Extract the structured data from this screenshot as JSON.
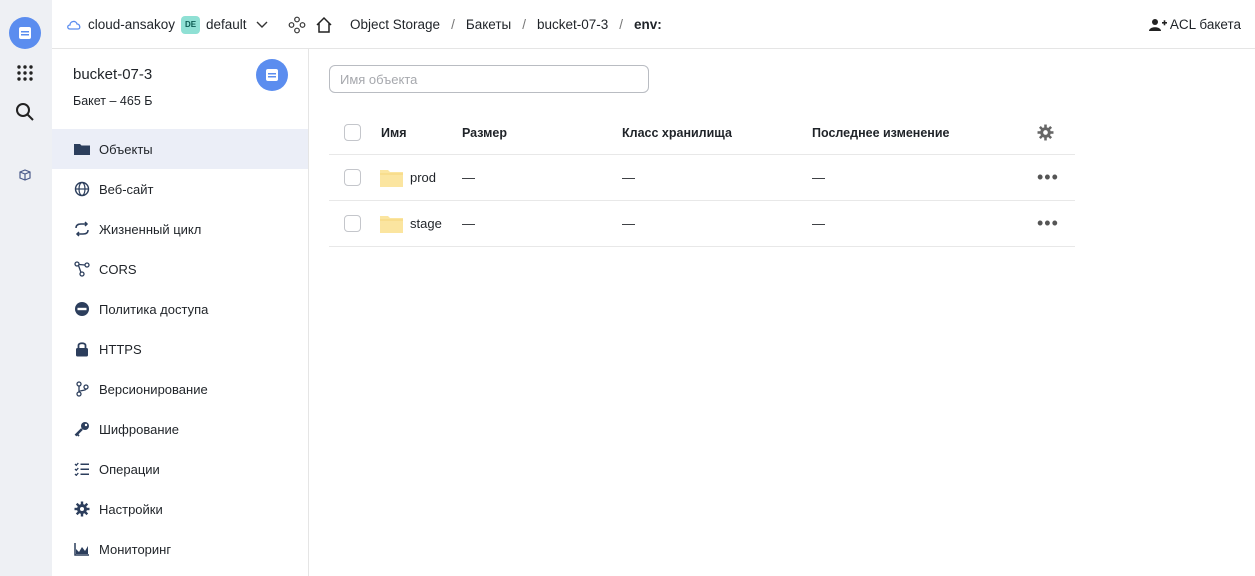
{
  "header": {
    "cloud_name": "cloud-ansakoy",
    "folder_badge": "DE",
    "folder_name": "default",
    "breadcrumbs": [
      "Object Storage",
      "Бакеты",
      "bucket-07-3",
      "env:"
    ],
    "separator": "/",
    "acl_label": "ACL бакета"
  },
  "sidebar": {
    "bucket_name": "bucket-07-3",
    "bucket_info": "Бакет – 465 Б",
    "items": [
      {
        "label": "Объекты",
        "icon": "folder-icon",
        "active": true
      },
      {
        "label": "Веб-сайт",
        "icon": "globe-icon"
      },
      {
        "label": "Жизненный цикл",
        "icon": "cycle-icon"
      },
      {
        "label": "CORS",
        "icon": "cors-icon"
      },
      {
        "label": "Политика доступа",
        "icon": "no-entry-icon"
      },
      {
        "label": "HTTPS",
        "icon": "lock-icon"
      },
      {
        "label": "Версионирование",
        "icon": "branch-icon"
      },
      {
        "label": "Шифрование",
        "icon": "key-icon"
      },
      {
        "label": "Операции",
        "icon": "checklist-icon"
      },
      {
        "label": "Настройки",
        "icon": "gear-icon"
      },
      {
        "label": "Мониторинг",
        "icon": "chart-icon"
      }
    ]
  },
  "search": {
    "placeholder": "Имя объекта"
  },
  "table": {
    "columns": [
      "Имя",
      "Размер",
      "Класс хранилища",
      "Последнее изменение"
    ],
    "rows": [
      {
        "name": "prod",
        "size": "—",
        "storage_class": "—",
        "modified": "—"
      },
      {
        "name": "stage",
        "size": "—",
        "storage_class": "—",
        "modified": "—"
      }
    ],
    "row_menu": "•••"
  },
  "colors": {
    "accent": "#5b8def",
    "active_nav": "#ebeef7",
    "folder": "#fbe5a0"
  }
}
